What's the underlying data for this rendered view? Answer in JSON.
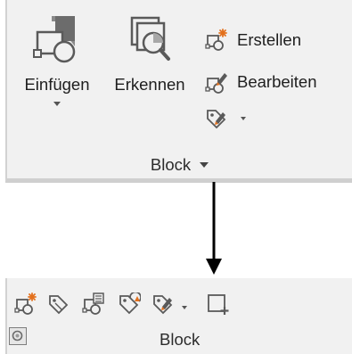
{
  "expanded_panel": {
    "buttons": {
      "einfuegen": "Einfügen",
      "erkennen": "Erkennen",
      "erstellen": "Erstellen",
      "bearbeiten": "Bearbeiten"
    },
    "title": "Block"
  },
  "collapsed_panel": {
    "title": "Block"
  },
  "colors": {
    "panel_bg": "#f1f1f1",
    "icon_stroke": "#5a5a5a",
    "accent_orange": "#e3701c",
    "text": "#1e1e1e"
  }
}
